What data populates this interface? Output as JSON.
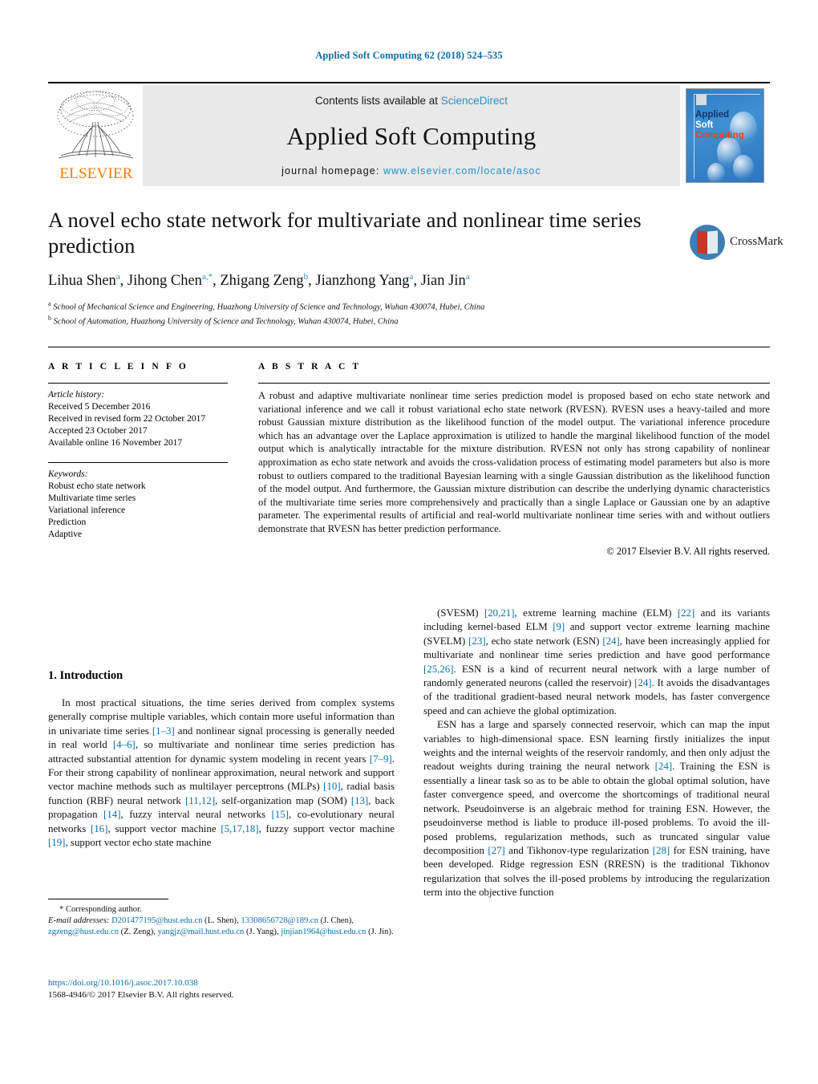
{
  "running_head": "Applied Soft Computing 62 (2018) 524–535",
  "masthead": {
    "publisher": "ELSEVIER",
    "contents_prefix": "Contents lists available at ",
    "contents_link": "ScienceDirect",
    "journal_name": "Applied Soft Computing",
    "homepage_prefix": "journal homepage: ",
    "homepage_url": "www.elsevier.com/locate/asoc",
    "cover": {
      "line1": "Applied",
      "line2": "Soft",
      "line3": "Computing"
    }
  },
  "crossmark": {
    "label": "CrossMark"
  },
  "article": {
    "title": "A novel echo state network for multivariate and nonlinear time series prediction",
    "authors_html": "Lihua Shen<sup>a</sup>, Jihong Chen<sup>a,*</sup>, Zhigang Zeng<sup>b</sup>, Jianzhong Yang<sup>a</sup>, Jian Jin<sup>a</sup>",
    "affiliations": [
      "a School of Mechanical Science and Engineering, Huazhong University of Science and Technology, Wuhan 430074, Hubei, China",
      "b School of Automation, Huazhong University of Science and Technology, Wuhan 430074, Hubei, China"
    ]
  },
  "info": {
    "heading": "A R T I C L E   I N F O",
    "history_title": "Article history:",
    "history": [
      "Received 5 December 2016",
      "Received in revised form 22 October 2017",
      "Accepted 23 October 2017",
      "Available online 16 November 2017"
    ],
    "keywords_title": "Keywords:",
    "keywords": [
      "Robust echo state network",
      "Multivariate time series",
      "Variational inference",
      "Prediction",
      "Adaptive"
    ]
  },
  "abstract": {
    "heading": "A B S T R A C T",
    "text": "A robust and adaptive multivariate nonlinear time series prediction model is proposed based on echo state network and variational inference and we call it robust variational echo state network (RVESN). RVESN uses a heavy-tailed and more robust Gaussian mixture distribution as the likelihood function of the model output. The variational inference procedure which has an advantage over the Laplace approximation is utilized to handle the marginal likelihood function of the model output which is analytically intractable for the mixture distribution. RVESN not only has strong capability of nonlinear approximation as echo state network and avoids the cross-validation process of estimating model parameters but also is more robust to outliers compared to the traditional Bayesian learning with a single Gaussian distribution as the likelihood function of the model output. And furthermore, the Gaussian mixture distribution can describe the underlying dynamic characteristics of the multivariate time series more comprehensively and practically than a single Laplace or Gaussian one by an adaptive parameter. The experimental results of artificial and real-world multivariate nonlinear time series with and without outliers demonstrate that RVESN has better prediction performance.",
    "copyright": "© 2017 Elsevier B.V. All rights reserved."
  },
  "body": {
    "section_title": "1.  Introduction",
    "left_paragraphs_html": [
      "In most practical situations, the time series derived from complex systems generally comprise multiple variables, which contain more useful information than in univariate time series <span class=\"ref\">[1–3]</span> and nonlinear signal processing is generally needed in real world <span class=\"ref\">[4–6]</span>, so multivariate and nonlinear time series prediction has attracted substantial attention for dynamic system modeling in recent years <span class=\"ref\">[7–9]</span>. For their strong capability of nonlinear approximation, neural network and support vector machine methods such as multilayer perceptrons (MLPs) <span class=\"ref\">[10]</span>, radial basis function (RBF) neural network <span class=\"ref\">[11,12]</span>, self-organization map (SOM) <span class=\"ref\">[13]</span>, back propagation <span class=\"ref\">[14]</span>, fuzzy interval neural networks <span class=\"ref\">[15]</span>, co-evolutionary neural networks <span class=\"ref\">[16]</span>, support vector machine <span class=\"ref\">[5,17,18]</span>, fuzzy support vector machine <span class=\"ref\">[19]</span>, support vector echo state machine"
    ],
    "right_paragraphs_html": [
      "(SVESM) <span class=\"ref\">[20,21]</span>, extreme learning machine (ELM) <span class=\"ref\">[22]</span> and its variants including kernel-based ELM <span class=\"ref\">[9]</span> and support vector extreme learning machine (SVELM) <span class=\"ref\">[23]</span>, echo state network (ESN) <span class=\"ref\">[24]</span>, have been increasingly applied for multivariate and nonlinear time series prediction and have good performance <span class=\"ref\">[25,26]</span>. ESN is a kind of recurrent neural network with a large number of randomly generated neurons (called the reservoir) <span class=\"ref\">[24]</span>. It avoids the disadvantages of the traditional gradient-based neural network models, has faster convergence speed and can achieve the global optimization.",
      "ESN has a large and sparsely connected reservoir, which can map the input variables to high-dimensional space. ESN learning firstly initializes the input weights and the internal weights of the reservoir randomly, and then only adjust the readout weights during training the neural network <span class=\"ref\">[24]</span>. Training the ESN is essentially a linear task so as to be able to obtain the global optimal solution, have faster convergence speed, and overcome the shortcomings of traditional neural network. Pseudoinverse is an algebraic method for training ESN. However, the pseudoinverse method is liable to produce ill-posed problems. To avoid the ill-posed problems, regularization methods, such as truncated singular value decomposition <span class=\"ref\">[27]</span> and Tikhonov-type regularization <span class=\"ref\">[28]</span> for ESN training, have been developed. Ridge regression ESN (RRESN) is the traditional Tikhonov regularization that solves the ill-posed problems by introducing the regularization term into the objective function"
    ]
  },
  "footnotes": {
    "corresponding": "* Corresponding author.",
    "emails_label": "E-mail addresses:",
    "emails_html": "<span class=\"link\">D201477195@hust.edu.cn</span> (L. Shen), <span class=\"link\">13308656728@189.cn</span> (J. Chen), <span class=\"link\">zgzeng@hust.edu.cn</span> (Z. Zeng), <span class=\"link\">yangjz@mail.hust.edu.cn</span> (J. Yang), <span class=\"link\">jinjian1964@hust.edu.cn</span> (J. Jin).",
    "doi": "https://doi.org/10.1016/j.asoc.2017.10.038",
    "issn": "1568-4946/© 2017 Elsevier B.V. All rights reserved."
  },
  "colors": {
    "link_blue": "#0b6ea8",
    "sciencedirect_blue": "#2b8fc4",
    "elsevier_orange": "#F07D00",
    "cover_blue": "#3f8fd2"
  }
}
